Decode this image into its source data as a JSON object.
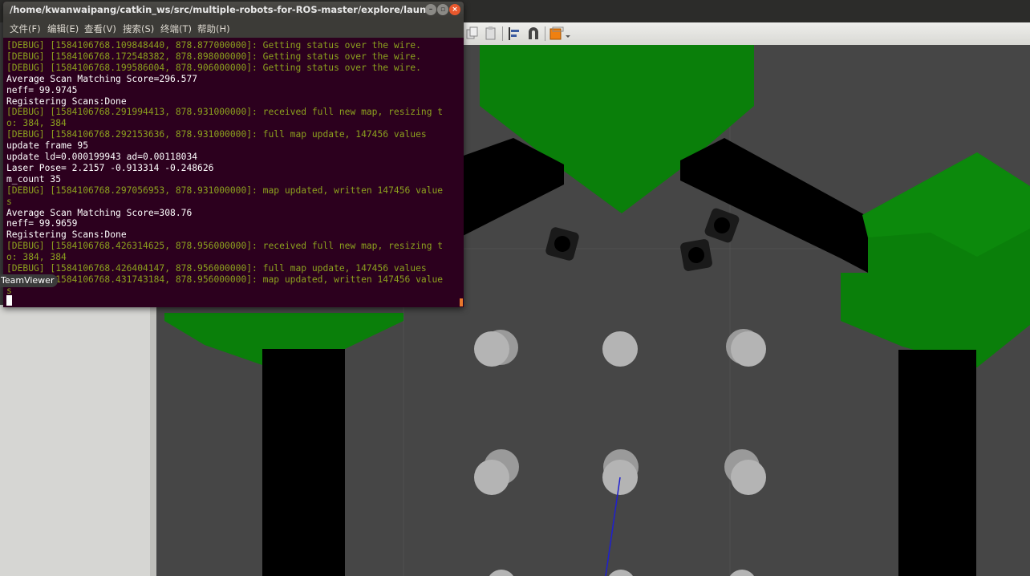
{
  "terminal": {
    "title": "/home/kwanwaipang/catkin_ws/src/multiple-robots-for-ROS-master/explore/launch/multi_...",
    "menus": [
      "文件(F)",
      "编辑(E)",
      "查看(V)",
      "搜索(S)",
      "终端(T)",
      "帮助(H)"
    ],
    "lines": [
      {
        "text": "[DEBUG] [1584106768.109848440, 878.877000000]: Getting status over the wire.",
        "kind": "debug"
      },
      {
        "text": "[DEBUG] [1584106768.172548382, 878.898000000]: Getting status over the wire.",
        "kind": "debug"
      },
      {
        "text": "[DEBUG] [1584106768.199586004, 878.906000000]: Getting status over the wire.",
        "kind": "debug"
      },
      {
        "text": "Average Scan Matching Score=296.577",
        "kind": "normal"
      },
      {
        "text": "neff= 99.9745",
        "kind": "normal"
      },
      {
        "text": "Registering Scans:Done",
        "kind": "normal"
      },
      {
        "text": "[DEBUG] [1584106768.291994413, 878.931000000]: received full new map, resizing t",
        "kind": "debug"
      },
      {
        "text": "o: 384, 384",
        "kind": "debug"
      },
      {
        "text": "[DEBUG] [1584106768.292153636, 878.931000000]: full map update, 147456 values",
        "kind": "debug"
      },
      {
        "text": "update frame 95",
        "kind": "normal"
      },
      {
        "text": "update ld=0.000199943 ad=0.00118034",
        "kind": "normal"
      },
      {
        "text": "Laser Pose= 2.2157 -0.913314 -0.248626",
        "kind": "normal"
      },
      {
        "text": "m_count 35",
        "kind": "normal"
      },
      {
        "text": "[DEBUG] [1584106768.297056953, 878.931000000]: map updated, written 147456 value",
        "kind": "debug"
      },
      {
        "text": "s",
        "kind": "debug"
      },
      {
        "text": "Average Scan Matching Score=308.76",
        "kind": "normal"
      },
      {
        "text": "neff= 99.9659",
        "kind": "normal"
      },
      {
        "text": "Registering Scans:Done",
        "kind": "normal"
      },
      {
        "text": "[DEBUG] [1584106768.426314625, 878.956000000]: received full new map, resizing t",
        "kind": "debug"
      },
      {
        "text": "o: 384, 384",
        "kind": "debug"
      },
      {
        "text": "[DEBUG] [1584106768.426404147, 878.956000000]: full map update, 147456 values",
        "kind": "debug"
      },
      {
        "text": "[DEBUG] [1584106768.431743184, 878.956000000]: map updated, written 147456 value",
        "kind": "debug"
      },
      {
        "text": "s",
        "kind": "debug"
      }
    ]
  },
  "overlay": {
    "teamviewer_label": "TeamViewer"
  },
  "colors": {
    "terminal_bg": "#2c001e",
    "debug_text": "#8ca01e",
    "obstacle_green": "#0a7f0a",
    "wall_black": "#000000",
    "floor": "#464646",
    "pillar": "#b4b4b4",
    "close_button": "#e9582d"
  }
}
